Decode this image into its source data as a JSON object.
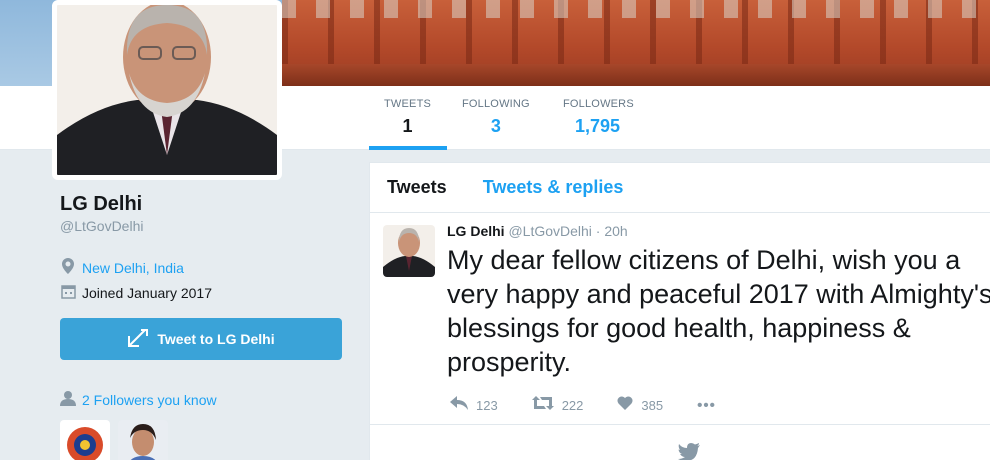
{
  "profile": {
    "name": "LG Delhi",
    "handle": "@LtGovDelhi",
    "location": "New Delhi, India",
    "joined": "Joined January 2017",
    "tweet_to_label": "Tweet to LG Delhi",
    "followers_you_know": "2 Followers you know"
  },
  "stats": {
    "tweets_label": "TWEETS",
    "tweets_value": "1",
    "following_label": "FOLLOWING",
    "following_value": "3",
    "followers_label": "FOLLOWERS",
    "followers_value": "1,795"
  },
  "timeline": {
    "tabs": [
      "Tweets",
      "Tweets & replies"
    ],
    "tweet": {
      "name": "LG Delhi",
      "handle_time": "@LtGovDelhi · 20h",
      "text": "My dear fellow citizens of Delhi, wish you a very happy and peaceful 2017 with Almighty's blessings for good health, happiness & prosperity.",
      "replies": "123",
      "retweets": "222",
      "likes": "385",
      "more": "•••"
    }
  },
  "icons": {
    "location": "map-pin-icon",
    "calendar": "calendar-icon",
    "compose": "quill-icon",
    "followers": "person-icon",
    "reply": "reply-icon",
    "retweet": "retweet-icon",
    "like": "heart-icon",
    "bird": "bird-icon"
  },
  "colors": {
    "accent": "#1da1f2",
    "button": "#3aa3d8",
    "muted": "#8899a6"
  }
}
